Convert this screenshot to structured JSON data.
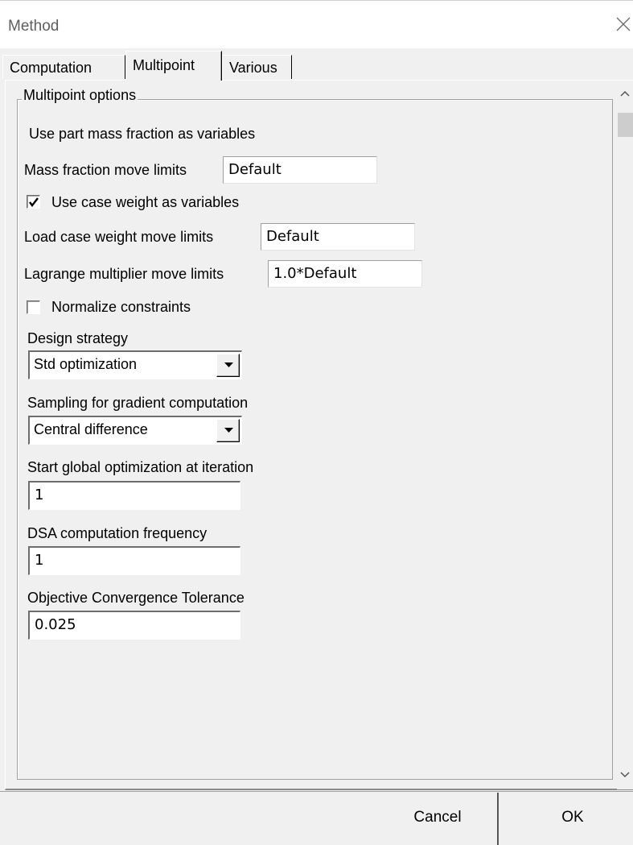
{
  "window": {
    "title": "Method",
    "close_icon": "close-icon"
  },
  "tabs": [
    {
      "label": "Computation",
      "active": false
    },
    {
      "label": "Multipoint",
      "active": true
    },
    {
      "label": "Various",
      "active": false
    }
  ],
  "group": {
    "label": "Multipoint options"
  },
  "fields": {
    "use_part_mass_fraction_label": "Use part mass fraction as variables",
    "mass_fraction_move_limits_label": "Mass fraction move limits",
    "mass_fraction_move_limits_value": "Default",
    "use_case_weight_label": "Use case weight as variables",
    "use_case_weight_checked": true,
    "load_case_weight_move_limits_label": "Load case weight move limits",
    "load_case_weight_move_limits_value": "Default",
    "lagrange_multiplier_move_limits_label": "Lagrange multiplier move limits",
    "lagrange_multiplier_move_limits_value": "1.0*Default",
    "normalize_constraints_label": "Normalize constraints",
    "normalize_constraints_checked": false,
    "design_strategy_label": "Design strategy",
    "design_strategy_value": "Std optimization",
    "sampling_label": "Sampling for gradient computation",
    "sampling_value": "Central difference",
    "start_global_opt_label": "Start global optimization at iteration",
    "start_global_opt_value": "1",
    "dsa_frequency_label": "DSA computation frequency",
    "dsa_frequency_value": "1",
    "objective_tolerance_label": "Objective Convergence Tolerance",
    "objective_tolerance_value": "0.025"
  },
  "footer": {
    "cancel_label": "Cancel",
    "ok_label": "OK"
  }
}
